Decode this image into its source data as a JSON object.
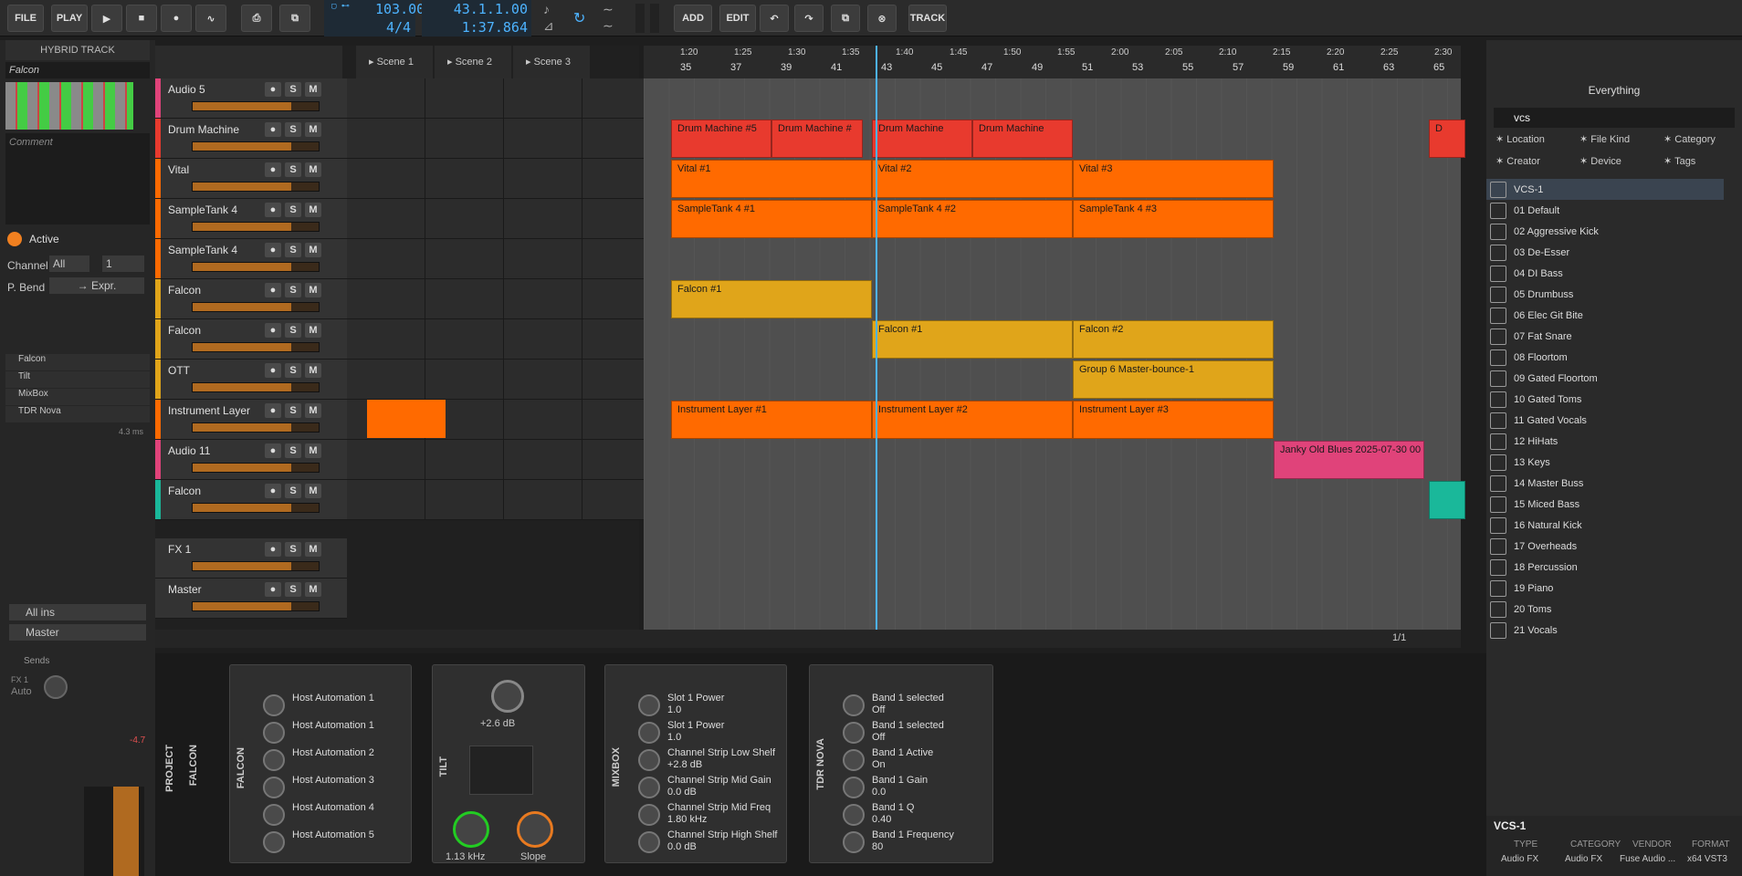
{
  "toolbar": {
    "file": "FILE",
    "play": "PLAY",
    "tempo": "103.00",
    "signature": "4/4",
    "position": "43.1.1.00",
    "time": "1:37.864",
    "add": "ADD",
    "edit": "EDIT",
    "track": "TRACK"
  },
  "inspector": {
    "title": "HYBRID TRACK",
    "name": "Falcon",
    "comment": "Comment",
    "active": "Active",
    "channel_label": "Channel",
    "channel_value": "All",
    "channel_num": "1",
    "pbend_label": "P. Bend",
    "pbend_value": "→ Expr.",
    "devices": [
      "Falcon",
      "Tilt",
      "MixBox",
      "TDR Nova"
    ],
    "latency": "4.3 ms",
    "input": "All ins",
    "output": "Master"
  },
  "scenes": [
    "Scene 1",
    "Scene 2",
    "Scene 3"
  ],
  "tracks": [
    {
      "name": "Audio 5",
      "color": "#e0437a"
    },
    {
      "name": "Drum Machine",
      "color": "#e83a2e"
    },
    {
      "name": "Vital",
      "color": "#ff6a00"
    },
    {
      "name": "SampleTank 4",
      "color": "#ff6a00"
    },
    {
      "name": "SampleTank 4",
      "color": "#ff6a00"
    },
    {
      "name": "Falcon",
      "color": "#e0a51a"
    },
    {
      "name": "Falcon",
      "color": "#e0a51a"
    },
    {
      "name": "OTT",
      "color": "#e0a51a"
    },
    {
      "name": "Instrument Layer",
      "color": "#ff6a00"
    },
    {
      "name": "Audio 11",
      "color": "#e0437a"
    },
    {
      "name": "Falcon",
      "color": "#1ab89a"
    }
  ],
  "fx_tracks": [
    {
      "name": "FX 1"
    },
    {
      "name": "Master"
    }
  ],
  "ruler": {
    "times": [
      "1:20",
      "1:25",
      "1:30",
      "1:35",
      "1:40",
      "1:45",
      "1:50",
      "1:55",
      "2:00",
      "2:05",
      "2:10",
      "2:15",
      "2:20",
      "2:25",
      "2:30"
    ],
    "bars": [
      "35",
      "37",
      "39",
      "41",
      "43",
      "45",
      "47",
      "49",
      "51",
      "53",
      "55",
      "57",
      "59",
      "61",
      "63",
      "65"
    ]
  },
  "clips": [
    {
      "track": 1,
      "name": "Drum Machine #5",
      "color": "#e83a2e"
    },
    {
      "track": 1,
      "name": "Drum Machine #",
      "color": "#e83a2e"
    },
    {
      "track": 1,
      "name": "Drum Machine",
      "color": "#e83a2e"
    },
    {
      "track": 1,
      "name": "Drum Machine",
      "color": "#e83a2e"
    },
    {
      "track": 1,
      "name": "D",
      "color": "#e83a2e"
    },
    {
      "track": 2,
      "name": "Vital #1",
      "color": "#ff6a00"
    },
    {
      "track": 2,
      "name": "Vital #2",
      "color": "#ff6a00"
    },
    {
      "track": 2,
      "name": "Vital #3",
      "color": "#ff6a00"
    },
    {
      "track": 3,
      "name": "SampleTank 4 #1",
      "color": "#ff6a00"
    },
    {
      "track": 3,
      "name": "SampleTank 4 #2",
      "color": "#ff6a00"
    },
    {
      "track": 3,
      "name": "SampleTank 4 #3",
      "color": "#ff6a00"
    },
    {
      "track": 5,
      "name": "Falcon #1",
      "color": "#e0a51a"
    },
    {
      "track": 6,
      "name": "Falcon #1",
      "color": "#e0a51a"
    },
    {
      "track": 6,
      "name": "Falcon #2",
      "color": "#e0a51a"
    },
    {
      "track": 7,
      "name": "Group 6 Master-bounce-1",
      "color": "#e0a51a"
    },
    {
      "track": 8,
      "name": "Instrument Layer #1",
      "color": "#ff6a00"
    },
    {
      "track": 8,
      "name": "Instrument Layer #2",
      "color": "#ff6a00"
    },
    {
      "track": 8,
      "name": "Instrument Layer #3",
      "color": "#ff6a00"
    },
    {
      "track": 9,
      "name": "Janky Old Blues 2025-07-30 00",
      "color": "#e0437a"
    },
    {
      "track": 10,
      "name": "",
      "color": "#1ab89a"
    }
  ],
  "browser": {
    "title": "Everything",
    "search": "vcs",
    "filters": [
      "Location",
      "File Kind",
      "Category",
      "Creator",
      "Device",
      "Tags"
    ],
    "items": [
      "VCS-1",
      "01 Default",
      "02 Aggressive Kick",
      "03 De-Esser",
      "04 DI Bass",
      "05 Drumbuss",
      "06 Elec Git Bite",
      "07 Fat Snare",
      "08 Floortom",
      "09 Gated Floortom",
      "10 Gated Toms",
      "11 Gated Vocals",
      "12 HiHats",
      "13 Keys",
      "14 Master Buss",
      "15 Miced Bass",
      "16 Natural Kick",
      "17 Overheads",
      "18 Percussion",
      "19 Piano",
      "20 Toms",
      "21 Vocals"
    ],
    "footer": {
      "name": "VCS-1",
      "type_h": "TYPE",
      "type": "Audio FX",
      "cat_h": "CATEGORY",
      "cat": "Audio FX",
      "vendor_h": "VENDOR",
      "vendor": "Fuse Audio ...",
      "format_h": "FORMAT",
      "format": "x64 VST3"
    }
  },
  "bottom_bar": {
    "page": "1/1"
  },
  "mixer": {
    "sends": "Sends",
    "fx1": "FX 1",
    "auto": "Auto",
    "level": "-4.7",
    "scale": [
      "0",
      "6",
      "12",
      "18",
      "24",
      "30",
      "36",
      "48",
      "∞"
    ]
  },
  "device_labels": {
    "project": "PROJECT",
    "falcon_track": "FALCON"
  },
  "devices": {
    "falcon": {
      "title": "FALCON",
      "params": [
        "Host Automation 1",
        "Host Automation 1",
        "Host Automation 2",
        "Host Automation 3",
        "Host Automation 4",
        "Host Automation 5"
      ]
    },
    "tilt": {
      "title": "TILT",
      "gain": "+2.6 dB",
      "freq": "1.13 kHz",
      "slope": "Slope"
    },
    "mixbox": {
      "title": "MIXBOX",
      "params": [
        [
          "Slot 1 Power",
          "1.0"
        ],
        [
          "Slot 1 Power",
          "1.0"
        ],
        [
          "Channel Strip Low Shelf",
          "+2.8 dB"
        ],
        [
          "Channel Strip Mid Gain",
          "0.0 dB"
        ],
        [
          "Channel Strip Mid Freq",
          "1.80 kHz"
        ],
        [
          "Channel Strip High Shelf",
          "0.0 dB"
        ]
      ]
    },
    "nova": {
      "title": "TDR NOVA",
      "params": [
        [
          "Band 1 selected",
          "Off"
        ],
        [
          "Band 1 selected",
          "Off"
        ],
        [
          "Band 1 Active",
          "On"
        ],
        [
          "Band 1 Gain",
          "0.0"
        ],
        [
          "Band 1 Q",
          "0.40"
        ],
        [
          "Band 1 Frequency",
          "80"
        ]
      ]
    }
  }
}
